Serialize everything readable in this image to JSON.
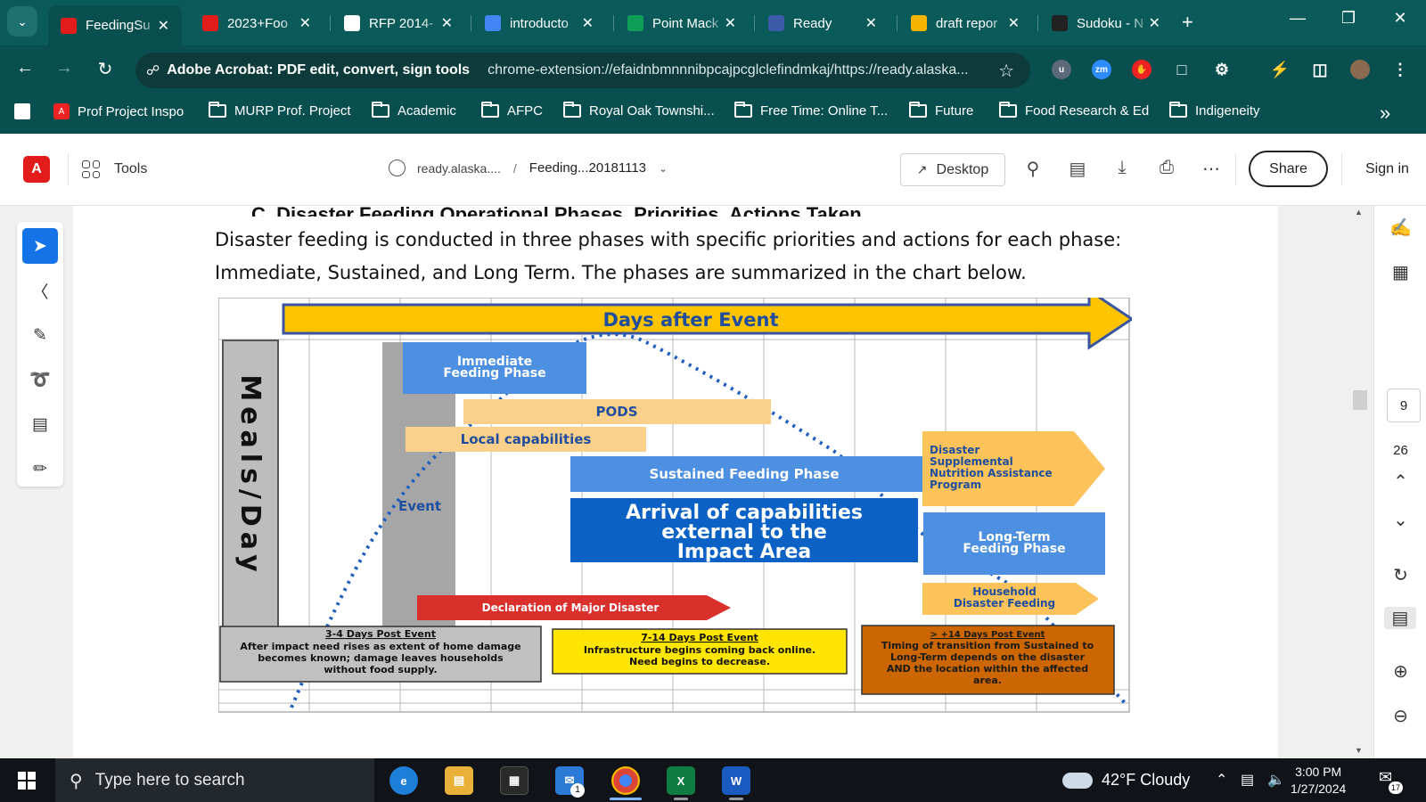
{
  "browser": {
    "tabs": [
      {
        "title": "FeedingSu",
        "icon": "acrobat-icon",
        "color": "#e21b1b",
        "active": true
      },
      {
        "title": "2023+Foo",
        "icon": "acrobat-icon",
        "color": "#e21b1b"
      },
      {
        "title": "RFP 2014-",
        "icon": "google-icon",
        "color": "#ffffff"
      },
      {
        "title": "introducto",
        "icon": "docs-icon",
        "color": "#4285f4"
      },
      {
        "title": "Point Mack",
        "icon": "sheets-icon",
        "color": "#0f9d58"
      },
      {
        "title": "Ready",
        "icon": "msb-icon",
        "color": "#3b5aa8"
      },
      {
        "title": "draft repor",
        "icon": "drive-icon",
        "color": "#f4b400"
      },
      {
        "title": "Sudoku - N",
        "icon": "nyt-icon",
        "color": "#222222"
      }
    ],
    "omnibox": {
      "site_name": "Adobe Acrobat: PDF edit, convert, sign tools",
      "url": "chrome-extension://efaidnbmnnnibpcajpcglclefindmkaj/https://ready.alaska..."
    },
    "bookmarks": [
      {
        "label": "Prof Project Inspo",
        "type": "acrobat"
      },
      {
        "label": "MURP Prof. Project",
        "type": "folder"
      },
      {
        "label": "Academic",
        "type": "folder"
      },
      {
        "label": "AFPC",
        "type": "folder"
      },
      {
        "label": "Royal Oak Townshi...",
        "type": "folder"
      },
      {
        "label": "Free Time: Online T...",
        "type": "folder"
      },
      {
        "label": "Future",
        "type": "folder"
      },
      {
        "label": "Food Research & Ed",
        "type": "folder"
      },
      {
        "label": "Indigeneity",
        "type": "folder"
      }
    ]
  },
  "acrobat": {
    "tools_label": "Tools",
    "breadcrumb_site": "ready.alaska....",
    "breadcrumb_file": "Feeding...20181113",
    "desktop_label": "Desktop",
    "share_label": "Share",
    "signin_label": "Sign in",
    "current_page": "9",
    "total_pages": "26"
  },
  "document": {
    "heading": "C.   Disaster Feeding Operational Phases, Priorities, Actions Taken",
    "paragraph": "Disaster feeding is conducted in three phases with specific priorities and actions for each phase: Immediate, Sustained, and Long Term. The phases are summarized in the chart below."
  },
  "diagram": {
    "banner": "Days after Event",
    "y_axis": "Meals/Day",
    "event_label": "Event",
    "immediate_phase": [
      "Immediate",
      "Feeding Phase"
    ],
    "pods": "PODS",
    "local_capabilities": "Local capabilities",
    "sustained_phase": "Sustained Feeding Phase",
    "arrival": [
      "Arrival of capabilities",
      "external to the",
      "Impact Area"
    ],
    "dsnap": [
      "Disaster",
      "Supplemental",
      "Nutrition Assistance",
      "Program"
    ],
    "long_term_phase": [
      "Long-Term",
      "Feeding Phase"
    ],
    "household": [
      "Household",
      "Disaster Feeding"
    ],
    "declaration": "Declaration of Major Disaster",
    "boxes": [
      {
        "title": "3-4 Days Post Event",
        "lines": [
          "After impact need rises as extent of home damage",
          "becomes known; damage leaves households",
          "without food supply."
        ],
        "fill": "#c0c0c0"
      },
      {
        "title": "7-14 Days Post Event",
        "lines": [
          "Infrastructure begins coming back online.",
          "Need begins to decrease."
        ],
        "fill": "#ffe600"
      },
      {
        "title": "> +14 Days Post Event",
        "lines": [
          "Timing of transition from Sustained to",
          "Long-Term depends on the disaster",
          "AND the location within the affected",
          "area."
        ],
        "fill": "#cc6600"
      }
    ]
  },
  "taskbar": {
    "search_placeholder": "Type here to search",
    "weather": "42°F  Cloudy",
    "time": "3:00 PM",
    "date": "1/27/2024",
    "notification_count": "17",
    "mail_badge": "1"
  }
}
